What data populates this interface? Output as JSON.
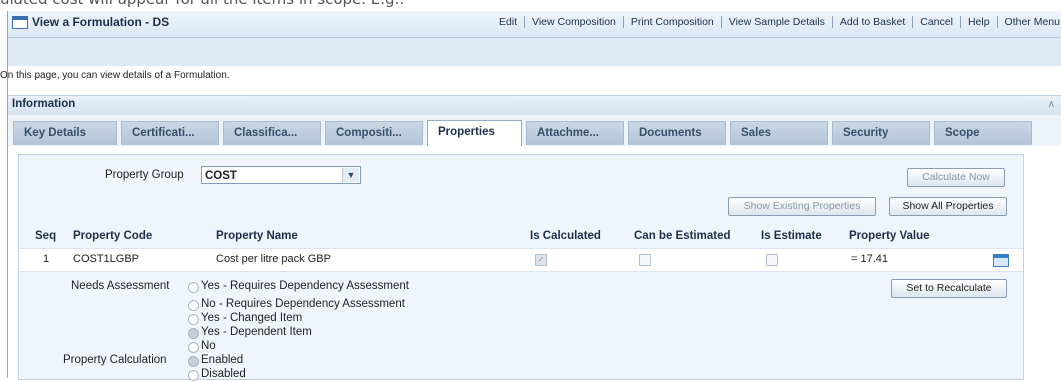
{
  "doc_line": "ulated cost will appear for all the items in scope. E.g.:",
  "window": {
    "title": "View a Formulation - DS",
    "menu": [
      "Edit",
      "View Composition",
      "Print Composition",
      "View Sample Details",
      "Add to Basket",
      "Cancel",
      "Help",
      "Other Menu"
    ]
  },
  "intro": "On this page, you can view details of a Formulation.",
  "section": {
    "title": "Information",
    "collapse_icon": "double-chevron-up-icon"
  },
  "tabs": [
    {
      "label": "Key Details",
      "active": false
    },
    {
      "label": "Certificati...",
      "active": false
    },
    {
      "label": "Classifica...",
      "active": false
    },
    {
      "label": "Compositi...",
      "active": false
    },
    {
      "label": "Properties",
      "active": true
    },
    {
      "label": "Attachme...",
      "active": false
    },
    {
      "label": "Documents",
      "active": false
    },
    {
      "label": "Sales",
      "active": false
    },
    {
      "label": "Security",
      "active": false
    },
    {
      "label": "Scope",
      "active": false
    }
  ],
  "properties": {
    "group_label": "Property Group",
    "group_value": "COST",
    "calculate_now": "Calculate Now",
    "show_existing": "Show Existing Properties",
    "show_all": "Show All Properties",
    "columns": [
      "Seq",
      "Property Code",
      "Property Name",
      "Is Calculated",
      "Can be Estimated",
      "Is Estimate",
      "Property Value"
    ],
    "rows": [
      {
        "seq": "1",
        "code": "COST1LGBP",
        "name": "Cost per litre pack GBP",
        "is_calculated": true,
        "can_be_estimated": false,
        "is_estimate": false,
        "value": "= 17.41"
      }
    ],
    "needs_assessment_label": "Needs Assessment",
    "needs_assessment_options": [
      {
        "label": "Yes - Requires Dependency Assessment",
        "selected": false
      },
      {
        "label": "No - Requires Dependency Assessment",
        "selected": false
      },
      {
        "label": "Yes - Changed Item",
        "selected": false
      },
      {
        "label": "Yes - Dependent Item",
        "selected": true
      },
      {
        "label": "No",
        "selected": false
      }
    ],
    "set_to_recalculate": "Set to Recalculate",
    "property_calculation_label": "Property Calculation",
    "property_calculation_options": [
      {
        "label": "Enabled",
        "selected": true
      },
      {
        "label": "Disabled",
        "selected": false
      }
    ]
  }
}
